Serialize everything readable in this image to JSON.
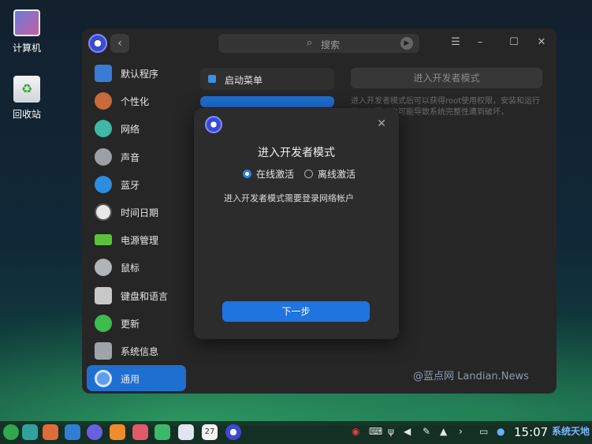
{
  "desktop": {
    "icons": [
      {
        "label": "计算机",
        "icon": "computer-icon"
      },
      {
        "label": "回收站",
        "icon": "trash-icon"
      }
    ]
  },
  "window": {
    "search_placeholder": "搜索",
    "sidebar": [
      {
        "label": "默认程序",
        "icon": "default-apps-icon",
        "color": "#3a7bd5"
      },
      {
        "label": "个性化",
        "icon": "personalization-icon",
        "color": "#c86a3a"
      },
      {
        "label": "网络",
        "icon": "network-icon",
        "color": "#3fb8a8"
      },
      {
        "label": "声音",
        "icon": "sound-icon",
        "color": "#9aa0a6"
      },
      {
        "label": "蓝牙",
        "icon": "bluetooth-icon",
        "color": "#2d8de0"
      },
      {
        "label": "时间日期",
        "icon": "clock-icon",
        "color": "#e8e8e8"
      },
      {
        "label": "电源管理",
        "icon": "battery-icon",
        "color": "#5cc23a"
      },
      {
        "label": "鼠标",
        "icon": "mouse-icon",
        "color": "#b0b4b8"
      },
      {
        "label": "键盘和语言",
        "icon": "keyboard-icon",
        "color": "#c8c8c8"
      },
      {
        "label": "更新",
        "icon": "update-icon",
        "color": "#3dbb4d"
      },
      {
        "label": "系统信息",
        "icon": "system-info-icon",
        "color": "#9fa4aa"
      },
      {
        "label": "通用",
        "icon": "general-icon",
        "color": "#5a9ff0",
        "active": true
      }
    ],
    "middle": {
      "items": [
        {
          "label": "启动菜单"
        },
        {
          "label": "",
          "active": true
        }
      ]
    },
    "right": {
      "button": "进入开发者模式",
      "description": "进入开发者模式后可以获得root使用权限，安装和运行非…但同时也可能导致系统完整性遭到破坏，"
    },
    "watermark": "@蓝点网 Landian.News"
  },
  "dialog": {
    "title": "进入开发者模式",
    "options": [
      {
        "label": "在线激活",
        "selected": true
      },
      {
        "label": "离线激活",
        "selected": false
      }
    ],
    "message": "进入开发者模式需要登录网络帐户",
    "next_button": "下一步"
  },
  "taskbar": {
    "clock": "15:07",
    "calendar_day": "27",
    "watermark": "系统天地"
  }
}
